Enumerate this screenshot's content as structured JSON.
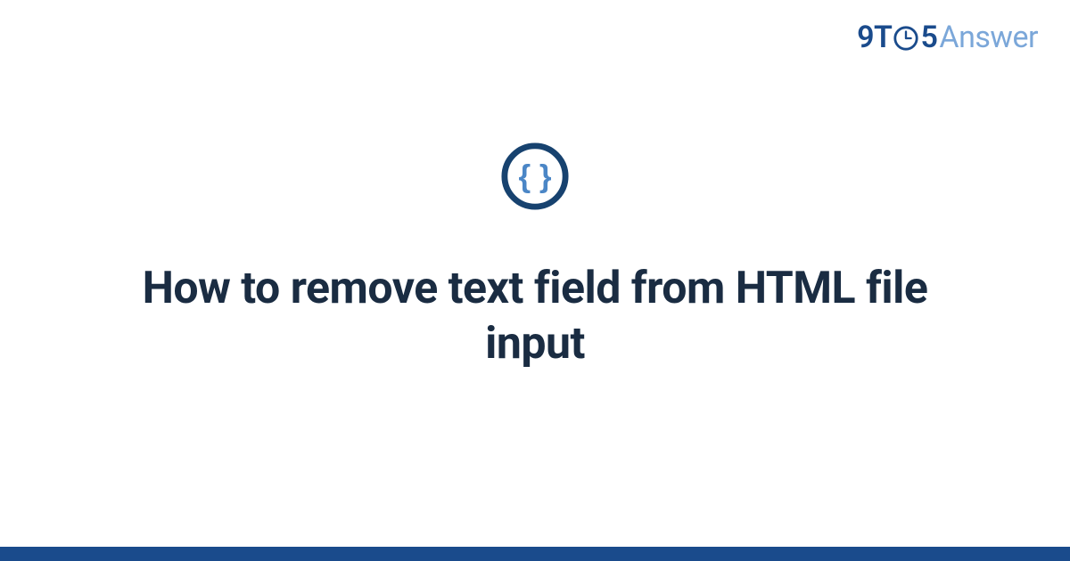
{
  "brand": {
    "prefix_nine": "9",
    "prefix_t": "T",
    "suffix_five": "5",
    "suffix_answer": "Answer"
  },
  "main": {
    "title": "How to remove text field from HTML file input"
  },
  "colors": {
    "brand_dark": "#1a4b8c",
    "brand_light": "#7ba7d9",
    "icon_ring": "#17426f",
    "icon_braces": "#4b86c6",
    "title_text": "#1a2c42"
  }
}
